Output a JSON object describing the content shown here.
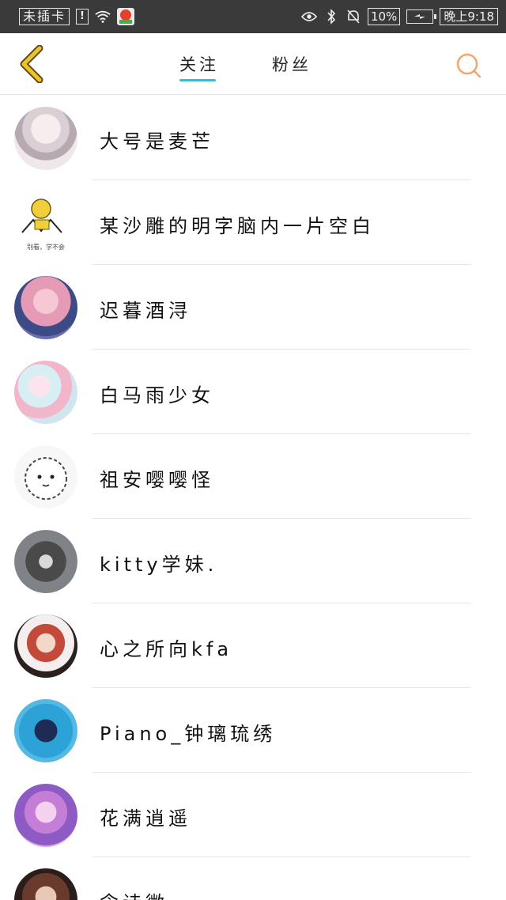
{
  "status_bar": {
    "sim": "未插卡",
    "alert": "!",
    "battery_percent": "10%",
    "time": "晚上9:18"
  },
  "header": {
    "tabs": [
      {
        "label": "关注",
        "active": true
      },
      {
        "label": "粉丝",
        "active": false
      }
    ],
    "accent_color": "#45b7c8",
    "back_color": "#f0c22a",
    "search_color": "#f3a56b"
  },
  "list": {
    "items": [
      {
        "name": "大号是麦芒"
      },
      {
        "name": "某沙雕的明字脑内一片空白",
        "avatar_caption": "别看，学不会"
      },
      {
        "name": "迟暮酒浔"
      },
      {
        "name": "白马雨少女"
      },
      {
        "name": "祖安嘤嘤怪"
      },
      {
        "name": "kitty学妹."
      },
      {
        "name": "心之所向kfa"
      },
      {
        "name": "Piano_钟璃琉绣"
      },
      {
        "name": "花满逍遥"
      },
      {
        "name": "念诗微"
      }
    ]
  }
}
